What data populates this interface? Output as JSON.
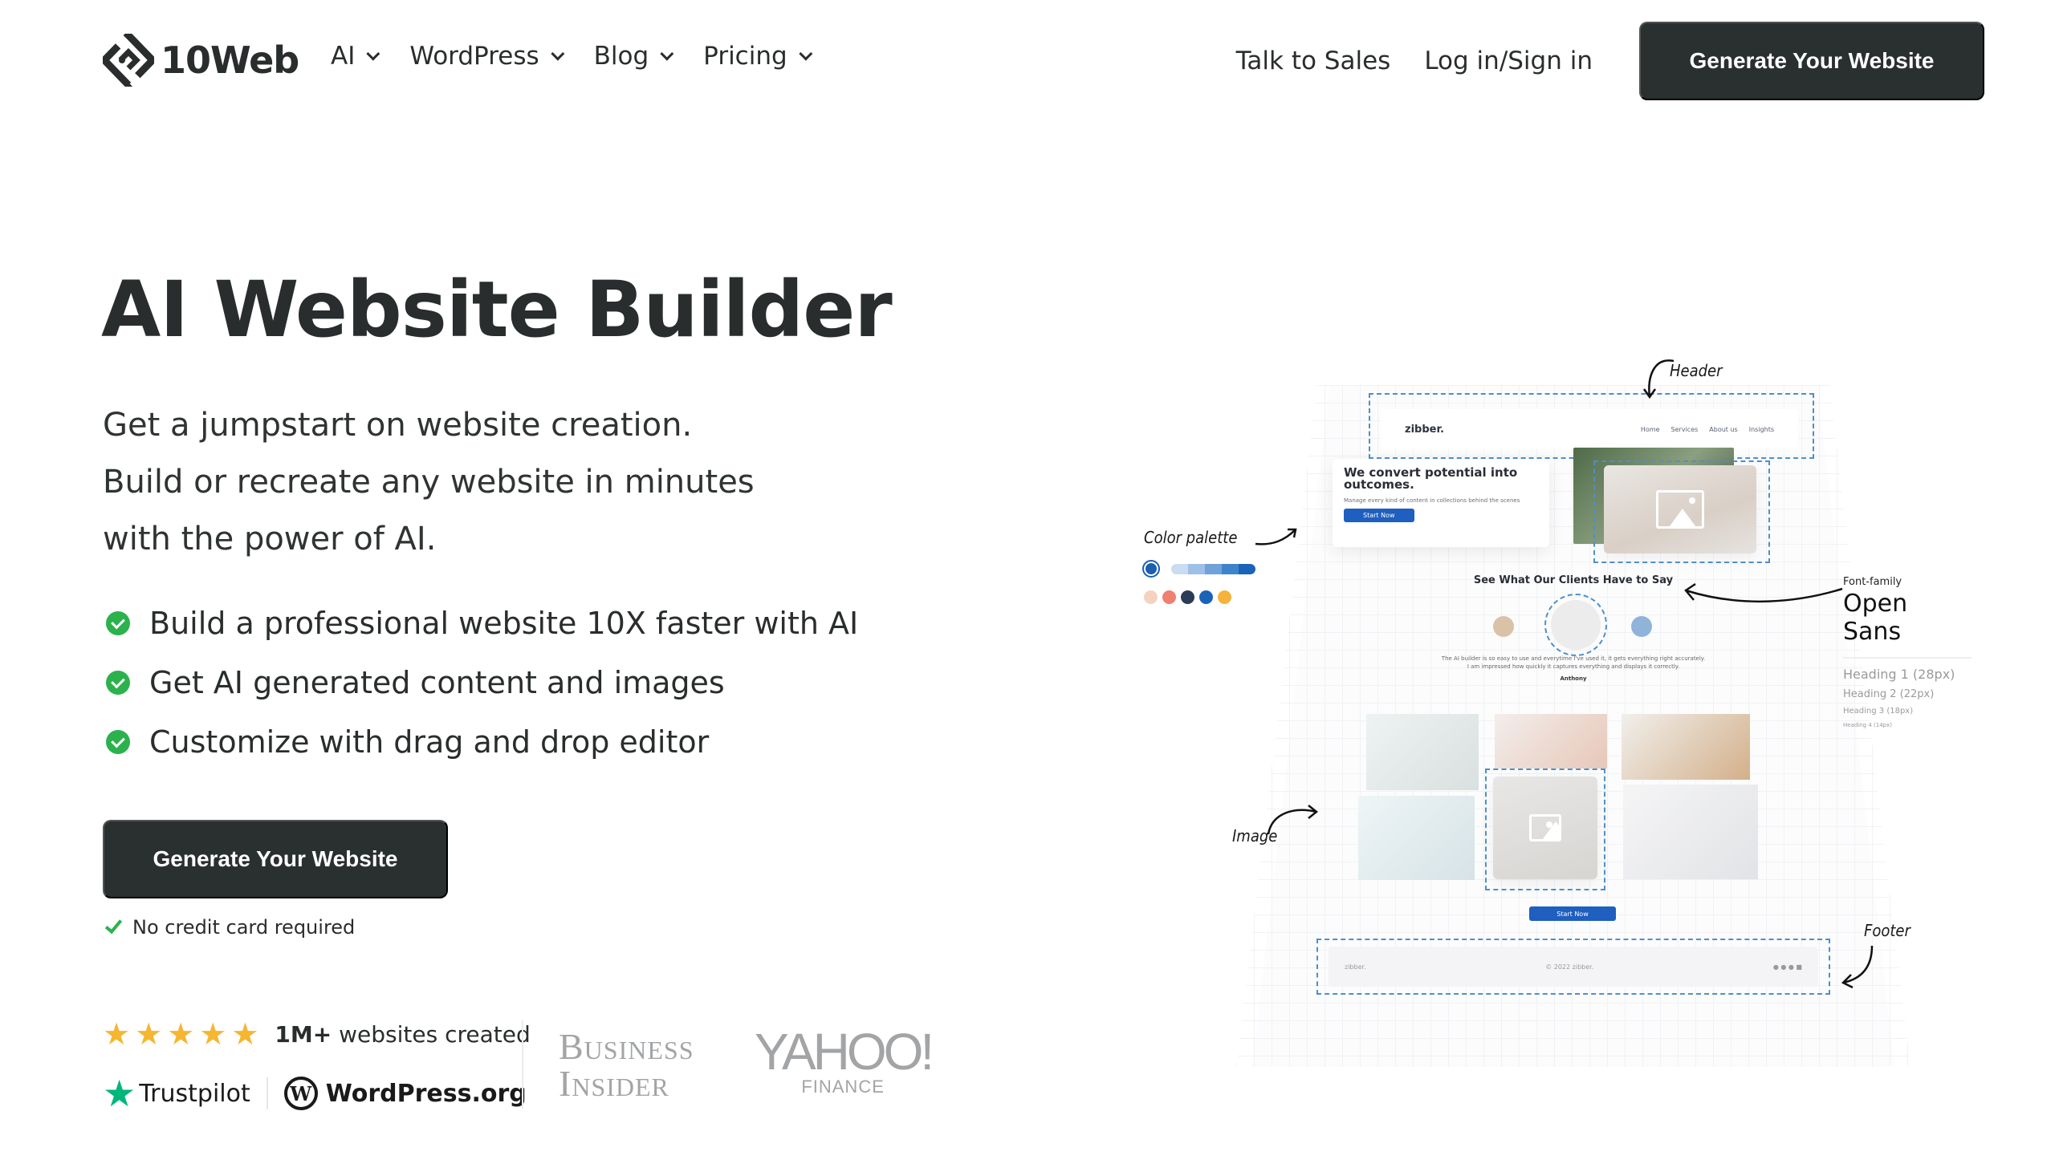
{
  "header": {
    "logo_text": "10Web",
    "menu": [
      {
        "label": "AI",
        "has_dropdown": true
      },
      {
        "label": "WordPress",
        "has_dropdown": true
      },
      {
        "label": "Blog",
        "has_dropdown": true
      },
      {
        "label": "Pricing",
        "has_dropdown": true
      }
    ],
    "talk_to_sales": "Talk to Sales",
    "login": "Log in/Sign in",
    "cta": "Generate Your Website"
  },
  "hero": {
    "title": "AI Website Builder",
    "subtitle_lines": [
      "Get a jumpstart on website creation.",
      "Build or recreate any website in minutes",
      "with the power of AI."
    ],
    "bullets": [
      "Build a professional website 10X faster with AI",
      "Get AI generated content and images",
      "Customize with drag and drop editor"
    ],
    "cta": "Generate Your Website",
    "no_credit_card": "No credit card required"
  },
  "proof": {
    "rating_stars": 5,
    "count_bold": "1M+",
    "count_text": " websites created",
    "trustpilot": "Trustpilot",
    "wordpress_org": "WordPress.org",
    "press": {
      "business_insider_line1": "Business",
      "business_insider_line2": "Insider",
      "yahoo_main": "YAHOO!",
      "yahoo_sub": "FINANCE"
    }
  },
  "mockup": {
    "annotations": {
      "header": "Header",
      "color_palette": "Color palette",
      "image": "Image",
      "footer": "Footer"
    },
    "site": {
      "brand": "zibber.",
      "nav": [
        "Home",
        "Services",
        "About us",
        "Insights"
      ],
      "hero_title": "We convert potential into outcomes.",
      "hero_desc": "Manage every kind of content in collections behind the scenes",
      "start_now": "Start Now",
      "testimonials_title": "See What Our Clients Have to Say",
      "quote_line1": "The AI builder is so easy to use and everytime I've used it, it gets everything right accurately.",
      "quote_line2": "I am impressed how quickly it captures everything and displays it correctly.",
      "quote_author": "Anthony",
      "footer_brand": "zibber.",
      "footer_copyright": "© 2022 zibber."
    },
    "palette": {
      "gradient": [
        "#c9dcf0",
        "#9dc0e6",
        "#6ea2d8",
        "#3f84cb",
        "#1b63b8"
      ],
      "dots": [
        "#f3d3c0",
        "#f07f70",
        "#2a3c57",
        "#1b63b8",
        "#f5b33b"
      ]
    },
    "font_panel": {
      "label": "Font-family",
      "font_name": "Open Sans",
      "headings": [
        "Heading 1 (28px)",
        "Heading 2 (22px)",
        "Heading 3 (18px)",
        "Heading 4 (14px)"
      ]
    }
  },
  "colors": {
    "dark": "#2a2f2f",
    "check_green": "#2bb24c",
    "star_yellow": "#f5b630",
    "trustpilot_green": "#00b67a",
    "mock_blue": "#1e5fbf"
  }
}
